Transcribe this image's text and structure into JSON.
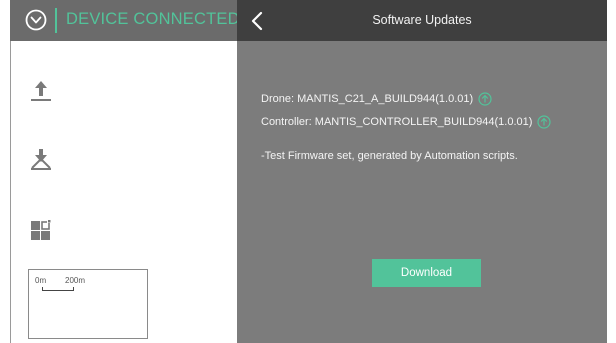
{
  "header": {
    "connection_status": "DEVICE CONNECTED",
    "title": "Software Updates"
  },
  "updates": {
    "drone": "Drone: MANTIS_C21_A_BUILD944(1.0.01)",
    "controller": "Controller: MANTIS_CONTROLLER_BUILD944(1.0.01)",
    "note": "-Test Firmware set, generated by Automation scripts."
  },
  "map_scale": {
    "left_label": "0m",
    "right_label": "200m"
  },
  "actions": {
    "download_label": "Download"
  },
  "icons": {
    "status": "connection-status-icon",
    "back": "chevron-left-icon",
    "takeoff": "takeoff-icon",
    "land": "landing-icon",
    "apps": "apps-grid-icon",
    "available": "upload-arrow-icon"
  },
  "colors": {
    "accent": "#52c39a",
    "top_bar_left": "#6b6b6b",
    "top_bar_right": "#3f3f3f",
    "panel": "#7c7c7c"
  }
}
